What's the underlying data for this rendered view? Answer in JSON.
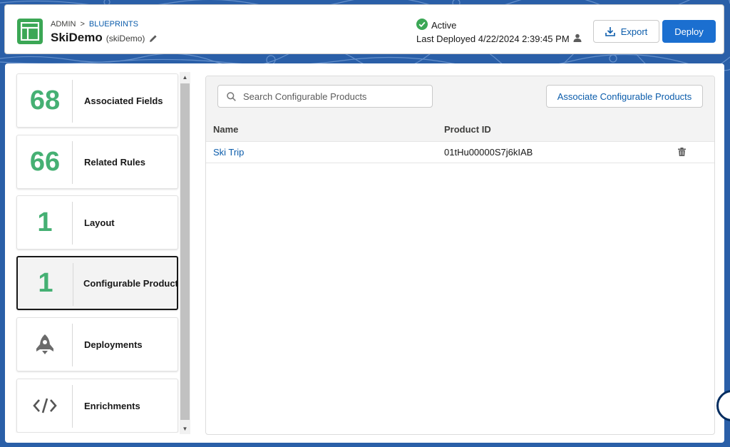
{
  "colors": {
    "accent": "#1b6fd0",
    "link": "#0b5cab",
    "count_green": "#45b073",
    "active_green": "#3ba755"
  },
  "header": {
    "breadcrumb": {
      "root": "ADMIN",
      "separator": ">",
      "current": "BLUEPRINTS"
    },
    "title": "SkiDemo",
    "api_name": "(skiDemo)",
    "status": "Active",
    "last_deployed": "Last Deployed 4/22/2024 2:39:45 PM",
    "export_label": "Export",
    "deploy_label": "Deploy"
  },
  "sidebar": {
    "cards": [
      {
        "count": "68",
        "label": "Associated Fields"
      },
      {
        "count": "66",
        "label": "Related Rules"
      },
      {
        "count": "1",
        "label": "Layout"
      },
      {
        "count": "1",
        "label": "Configurable Product",
        "selected": true
      },
      {
        "icon": "rocket-icon",
        "label": "Deployments"
      },
      {
        "icon": "code-icon",
        "label": "Enrichments"
      }
    ]
  },
  "main": {
    "search_placeholder": "Search Configurable Products",
    "associate_label": "Associate Configurable Products",
    "columns": [
      "Name",
      "Product ID"
    ],
    "rows": [
      {
        "name": "Ski Trip",
        "product_id": "01tHu00000S7j6kIAB"
      }
    ]
  }
}
